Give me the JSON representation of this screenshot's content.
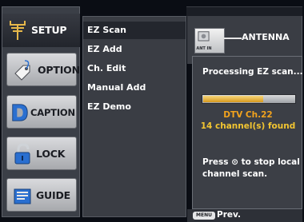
{
  "sidebar": {
    "items": [
      {
        "label": "SETUP",
        "icon": "setup-antenna-icon",
        "active": true
      },
      {
        "label": "OPTION",
        "icon": "option-tag-icon",
        "active": false
      },
      {
        "label": "CAPTION",
        "icon": "caption-d-icon",
        "active": false
      },
      {
        "label": "LOCK",
        "icon": "padlock-icon",
        "active": false
      },
      {
        "label": "GUIDE",
        "icon": "guide-book-icon",
        "active": false
      }
    ]
  },
  "menu": {
    "items": [
      {
        "label": "EZ Scan",
        "selected": true
      },
      {
        "label": "EZ Add",
        "selected": false
      },
      {
        "label": "Ch. Edit",
        "selected": false
      },
      {
        "label": "Manual Add",
        "selected": false
      },
      {
        "label": "EZ Demo",
        "selected": false
      }
    ]
  },
  "antenna": {
    "label": "ANTENNA",
    "jack_label": "ANT IN",
    "icon": "antenna-jack-icon"
  },
  "scan_panel": {
    "title": "Processing EZ scan...",
    "progress": 0.66,
    "channel": "DTV Ch.22",
    "found": "14 channel(s) found",
    "stop_message": "Press ⊙ to stop local channel scan."
  },
  "footer": {
    "menu_key": "MENU",
    "prev_label": "Prev."
  },
  "colors": {
    "accent_orange": "#f2a31d",
    "accent_yellow": "#f2c531",
    "panel_bg": "#3c3f46",
    "progress_fill": "#d79a1e"
  }
}
